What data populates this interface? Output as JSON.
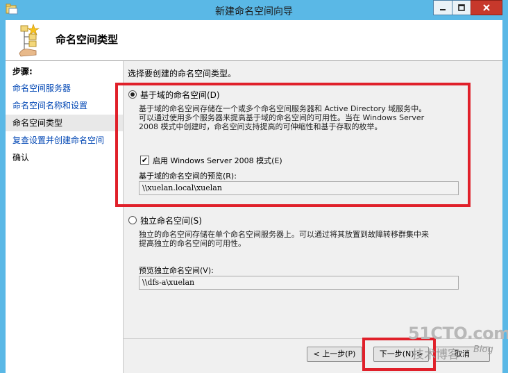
{
  "window": {
    "title": "新建命名空间向导",
    "controls": {
      "minimize_icon": "minimize-icon",
      "maximize_icon": "maximize-icon",
      "close_icon": "close-icon"
    }
  },
  "header": {
    "title": "命名空间类型"
  },
  "sidebar": {
    "steps_label": "步骤:",
    "items": [
      {
        "label": "命名空间服务器",
        "state": "link"
      },
      {
        "label": "命名空间名称和设置",
        "state": "link"
      },
      {
        "label": "命名空间类型",
        "state": "current"
      },
      {
        "label": "复查设置并创建命名空间",
        "state": "link"
      },
      {
        "label": "确认",
        "state": "plain"
      }
    ]
  },
  "main": {
    "instruction": "选择要创建的命名空间类型。",
    "domain_option": {
      "label": "基于域的命名空间(D)",
      "selected": true,
      "description_line1": "基于域的命名空间存储在一个或多个命名空间服务器和 Active Directory 域服务中。",
      "description_line2": "可以通过使用多个服务器来提高基于域的命名空间的可用性。当在 Windows Server",
      "description_line3": "2008 模式中创建时，命名空间支持提高的可伸缩性和基于存取的枚举。",
      "ws2008_checkbox": {
        "label": "启用 Windows Server 2008 模式(E)",
        "checked": true
      },
      "preview_label": "基于域的命名空间的预览(R):",
      "preview_value": "\\\\xuelan.local\\xuelan"
    },
    "standalone_option": {
      "label": "独立命名空间(S)",
      "selected": false,
      "description_line1": "独立的命名空间存储在单个命名空间服务器上。可以通过将其放置到故障转移群集中来",
      "description_line2": "提高独立的命名空间的可用性。",
      "preview_label": "预览独立命名空间(V):",
      "preview_value": "\\\\dfs-a\\xuelan"
    }
  },
  "footer": {
    "back_label": "< 上一步(P)",
    "next_label": "下一步(N) >",
    "cancel_label": "取消"
  },
  "watermark": {
    "line1": "51CTO.com",
    "line2": "技术博客",
    "line3": "Blog"
  },
  "colors": {
    "titlebar": "#5ab8e6",
    "annotation_red": "#e0202a",
    "link_blue": "#0046b4"
  }
}
